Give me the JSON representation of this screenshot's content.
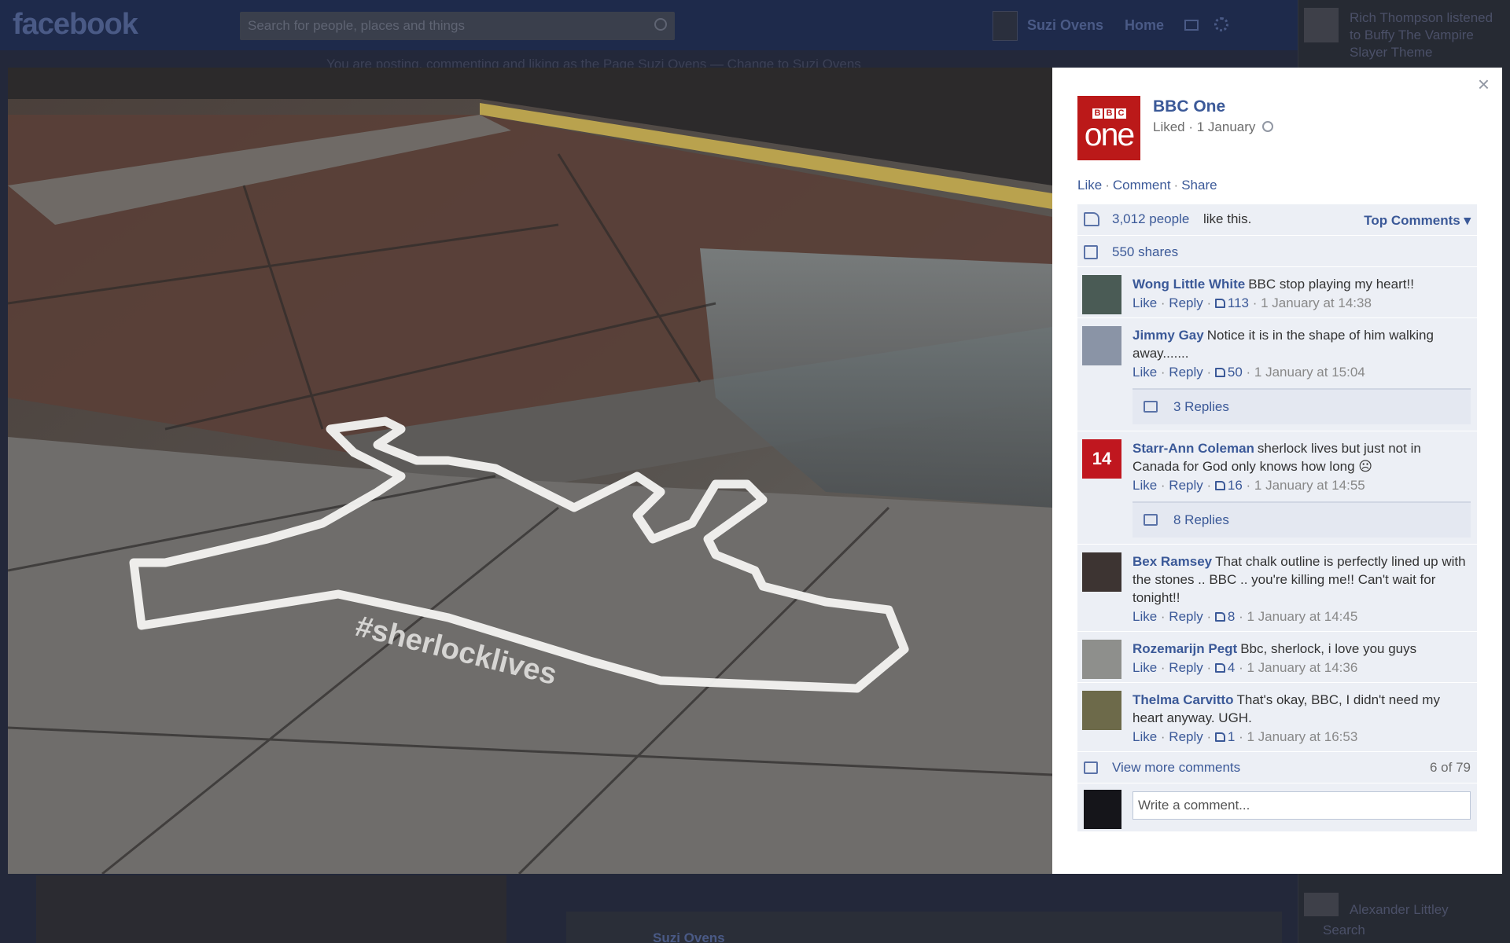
{
  "background_page": {
    "logo": "facebook",
    "search_placeholder": "Search for people, places and things",
    "profile_name": "Suzi Ovens",
    "home_label": "Home",
    "posting_as_notice": "You are posting, commenting and liking as the Page Suzi Ovens — Change to Suzi Ovens",
    "ticker_text": "Rich Thompson listened to Buffy The Vampire Slayer Theme",
    "rail_bottom_name": "Alexander Littley",
    "rail_search": "Search",
    "post_name": "Suzi Ovens"
  },
  "photo": {
    "hashtag": "#sherlocklives"
  },
  "panel": {
    "close_label": "×",
    "page_name": "BBC One",
    "avatar_text": {
      "letters": [
        "B",
        "B",
        "C"
      ],
      "word": "one"
    },
    "meta": "Liked · 1 January",
    "actions": [
      "Like",
      "Comment",
      "Share"
    ],
    "likes_count": "3,012 people",
    "likes_suffix": "like this.",
    "top_comments": "Top Comments ▾",
    "shares": "550 shares",
    "view_more": "View more comments",
    "more_count": "6 of 79",
    "write_placeholder": "Write a comment...",
    "meta_labels": {
      "like": "Like",
      "reply": "Reply"
    }
  },
  "comments": [
    {
      "author": "Wong Little White",
      "text": "BBC stop playing my heart!!",
      "likes": "113",
      "time": "1 January at 14:38",
      "avatar_color": "#4a5b55"
    },
    {
      "author": "Jimmy Gay",
      "text": "Notice it is in the shape of him walking away.......",
      "likes": "50",
      "time": "1 January at 15:04",
      "replies": "3 Replies",
      "avatar_color": "#8a94a6"
    },
    {
      "author": "Starr-Ann Coleman",
      "text": "sherlock lives but just not in Canada for God only knows how long ☹",
      "likes": "16",
      "time": "1 January at 14:55",
      "replies": "8 Replies",
      "avatar_color": "#c0171f",
      "avatar_text": "14"
    },
    {
      "author": "Bex Ramsey",
      "text": "That chalk outline is perfectly lined up with the stones .. BBC .. you're killing me!! Can't wait for tonight!!",
      "likes": "8",
      "time": "1 January at 14:45",
      "avatar_color": "#3d3432"
    },
    {
      "author": "Rozemarijn Pegt",
      "text": "Bbc, sherlock, i love you guys",
      "likes": "4",
      "time": "1 January at 14:36",
      "avatar_color": "#8e8f8c"
    },
    {
      "author": "Thelma Carvitto",
      "text": "That's okay, BBC, I didn't need my heart anyway. UGH.",
      "likes": "1",
      "time": "1 January at 16:53",
      "avatar_color": "#6d6a4a"
    }
  ],
  "colors": {
    "link": "#3b5998",
    "bbc_red": "#bb1919",
    "ufi_background": "#eceff5"
  },
  "icons": [
    "close-icon",
    "globe-icon",
    "thumbs-up-icon",
    "share-icon",
    "reply-icon",
    "comment-icon",
    "search-icon"
  ]
}
